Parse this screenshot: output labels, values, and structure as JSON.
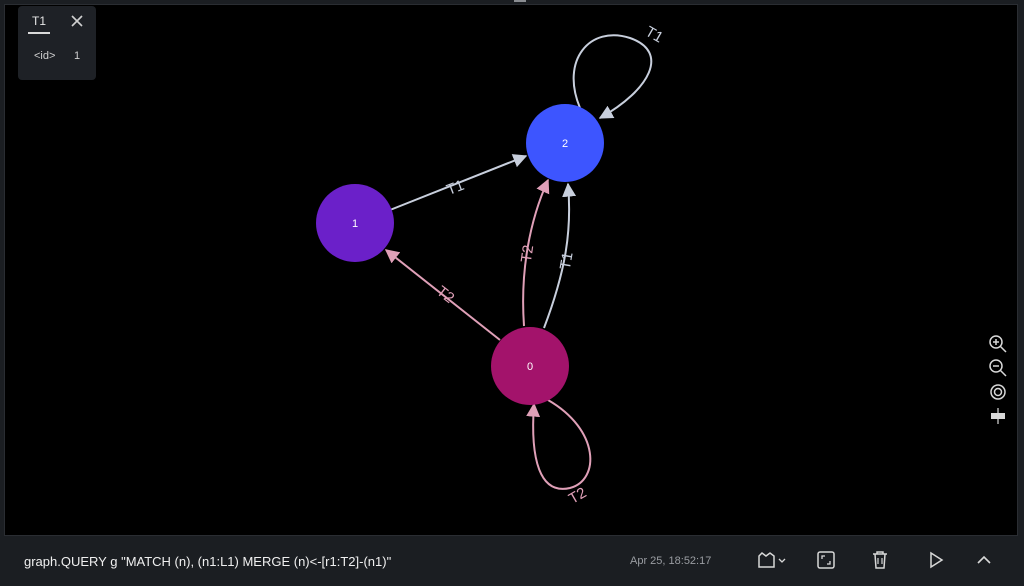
{
  "inspect_panel": {
    "tab_label": "T1",
    "property_key": "<id>",
    "property_value": "1"
  },
  "graph": {
    "nodes": [
      {
        "id": "node-2",
        "label": "2",
        "color": "#3d55ff"
      },
      {
        "id": "node-1",
        "label": "1",
        "color": "#6b20c9"
      },
      {
        "id": "node-0",
        "label": "0",
        "color": "#a3136b"
      }
    ],
    "edges": [
      {
        "label": "T1",
        "color": "#c8cfdd"
      },
      {
        "label": "T1",
        "color": "#c8cfdd"
      },
      {
        "label": "T1",
        "color": "#c8cfdd"
      },
      {
        "label": "T2",
        "color": "#e0a0b8"
      },
      {
        "label": "T2",
        "color": "#e0a0b8"
      },
      {
        "label": "T2",
        "color": "#e0a0b8"
      }
    ]
  },
  "zoom_controls": {
    "icons": [
      "zoom-in-icon",
      "zoom-out-icon",
      "center-icon",
      "fit-icon"
    ]
  },
  "bottom_bar": {
    "query": "graph.QUERY g \"MATCH (n), (n1:L1) MERGE (n)<-[r1:T2]-(n1)\"",
    "timestamp": "Apr 25, 18:52:17",
    "icons": [
      "layout-icon",
      "fullscreen-icon",
      "delete-icon",
      "run-icon",
      "collapse-icon"
    ]
  },
  "colors": {
    "background": "#000000",
    "panel": "#1e2126",
    "t1_edge": "#c8cfdd",
    "t2_edge": "#e0a0b8"
  }
}
